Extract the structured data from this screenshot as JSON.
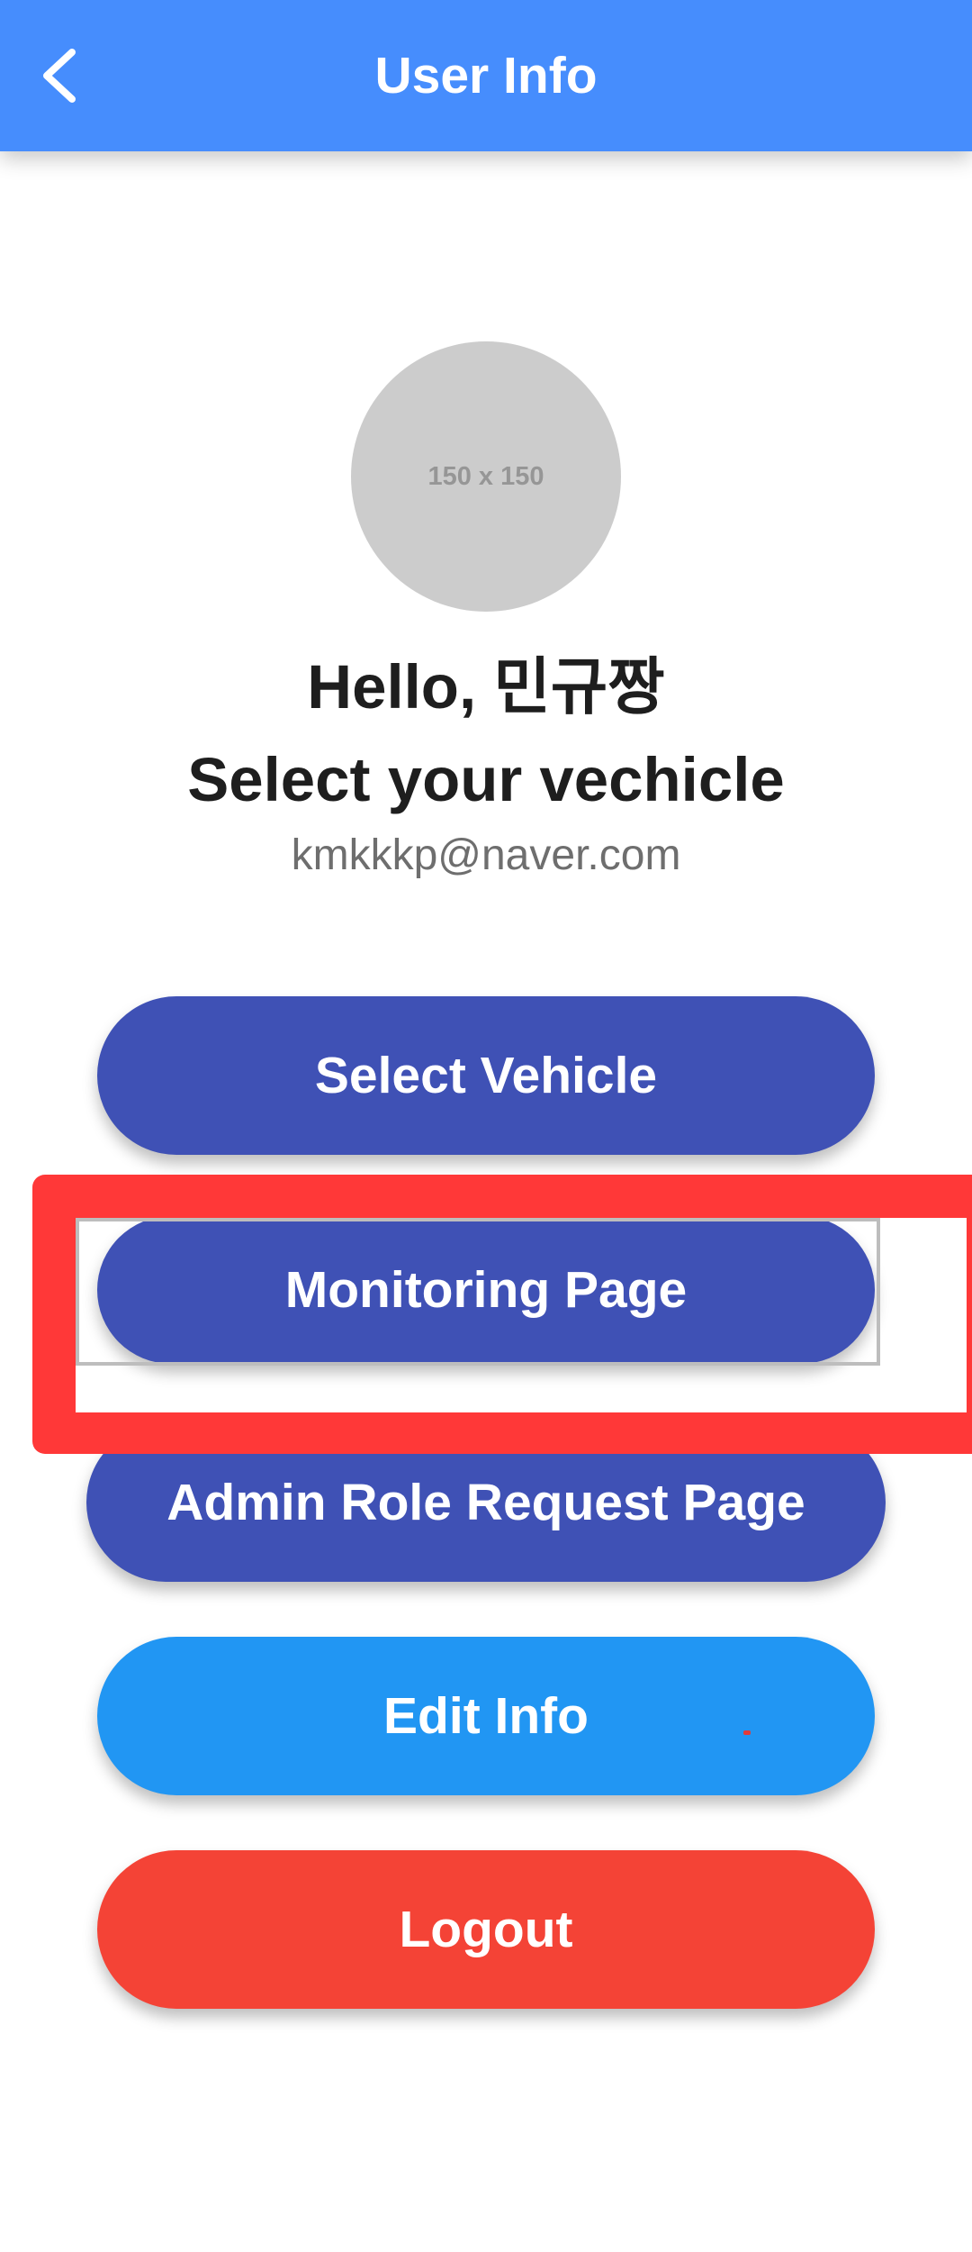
{
  "app_bar": {
    "title": "User Info",
    "background_color": "#468dfd",
    "back_icon": "chevron-left-icon"
  },
  "profile": {
    "avatar_placeholder": "150 x 150",
    "greeting": "Hello, 민규짱",
    "subtitle": "Select your vechicle",
    "email": "kmkkkp@naver.com"
  },
  "buttons": {
    "select_vehicle": "Select Vehicle",
    "monitoring_page": "Monitoring Page",
    "admin_role_request": "Admin Role Request Page",
    "edit_info": "Edit Info",
    "logout": "Logout"
  },
  "colors": {
    "primary_button": "#3f51b5",
    "edit_button": "#2196f3",
    "logout_button": "#f44336",
    "highlight": "#ff3838"
  }
}
